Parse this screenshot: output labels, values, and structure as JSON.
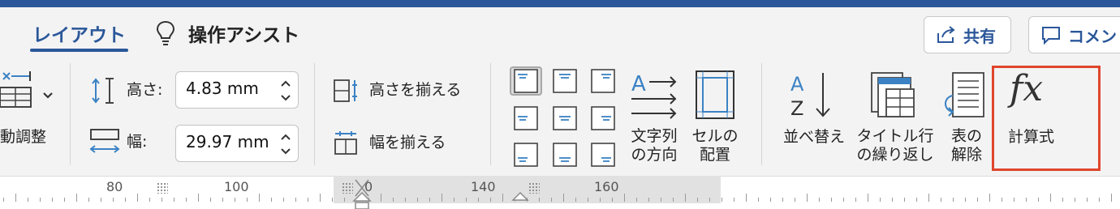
{
  "tabs": {
    "layout": "レイアウト",
    "assist": "操作アシスト"
  },
  "header": {
    "share_label": "共有",
    "comments_label": "コメン"
  },
  "autofit": {
    "label": "動調整"
  },
  "cell_size": {
    "height_label": "高さ:",
    "height_value": "4.83 mm",
    "width_label": "幅:",
    "width_value": "29.97 mm"
  },
  "distribute": {
    "rows_label": "高さを揃える",
    "cols_label": "幅を揃える"
  },
  "alignment": {
    "text_direction_line1": "文字列",
    "text_direction_line2": "の方向",
    "cell_margins_line1": "セルの",
    "cell_margins_line2": "配置",
    "selected": "top-left"
  },
  "data_group": {
    "sort_label": "並べ替え",
    "repeat_header_line1": "タイトル行",
    "repeat_header_line2": "の繰り返し",
    "convert_line1": "表の",
    "convert_line2": "解除",
    "formula_label": "計算式",
    "formula_glyph": "fx"
  },
  "ruler": {
    "ticks": [
      "80",
      "100",
      "0",
      "140",
      "160"
    ]
  },
  "colors": {
    "accent": "#2b579a",
    "highlight": "#e0452c",
    "icon_blue": "#3b82c4"
  }
}
